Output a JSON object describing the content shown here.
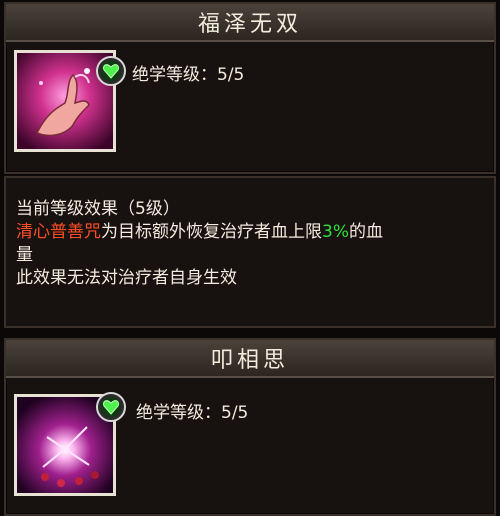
{
  "skill1": {
    "title": "福泽无双",
    "level_label": "绝学等级：",
    "level_value": "5/5",
    "icon": "praying-hand-icon",
    "gem_icon": "green-heart-gem-icon"
  },
  "effects": {
    "header_prefix": "当前等级效果（",
    "header_level": "5级",
    "header_suffix": "）",
    "line1_skill": "清心普善咒",
    "line1_text": "为目标额外恢复治疗者血上限",
    "line1_percent": "3%",
    "line1_suffix": "的血",
    "line2": "量",
    "line3": "此效果无法对治疗者自身生效"
  },
  "skill2": {
    "title": "叩相思",
    "level_label": "绝学等级：",
    "level_value": "5/5",
    "icon": "pink-burst-icon",
    "gem_icon": "green-heart-gem-icon"
  },
  "colors": {
    "skill_name": "#ff4d24",
    "percent": "#2fe23a",
    "panel_bg": "#171210",
    "header_bg": "#3e3530"
  }
}
